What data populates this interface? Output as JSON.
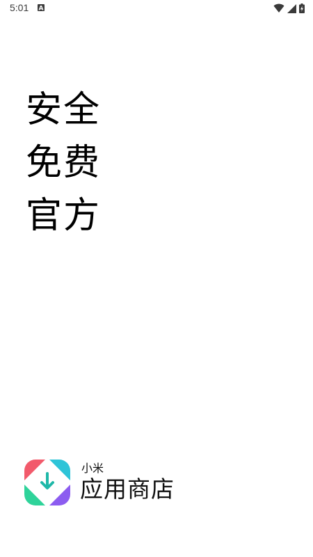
{
  "status_bar": {
    "time": "5:01",
    "notification_icon": "a-square-icon",
    "wifi_icon": "wifi-icon",
    "signal_icon": "cell-signal-icon",
    "battery_icon": "battery-charging-icon"
  },
  "slogan": {
    "lines": [
      "安全",
      "免费",
      "官方"
    ]
  },
  "brand": {
    "subtitle": "小米",
    "name": "应用商店",
    "logo_colors": {
      "red": "#f25a6b",
      "cyan": "#2ec4d8",
      "green": "#2fd39a",
      "purple": "#8c5cf0",
      "arrow": "#1fb8a8"
    }
  }
}
